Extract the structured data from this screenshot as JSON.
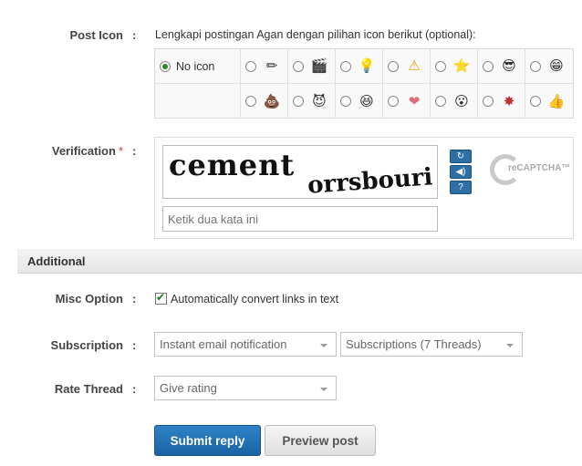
{
  "post_icon": {
    "label": "Post Icon",
    "colon": ":",
    "description": "Lengkapi postingan Agan dengan pilihan icon berikut (optional):",
    "no_icon_label": "No icon",
    "row1_icons": [
      {
        "name": "pencil-icon",
        "glyph": "✏"
      },
      {
        "name": "clapper-icon",
        "glyph": "🎬"
      },
      {
        "name": "lightbulb-icon",
        "glyph": "💡"
      },
      {
        "name": "warning-icon",
        "glyph": "⚠"
      },
      {
        "name": "star-icon",
        "glyph": "⭐"
      },
      {
        "name": "cool-face-icon",
        "glyph": "😎"
      },
      {
        "name": "smiley-face-icon",
        "glyph": "😁"
      }
    ],
    "row2_icons": [
      {
        "name": "poop-icon",
        "glyph": "💩"
      },
      {
        "name": "evil-face-icon",
        "glyph": "😈"
      },
      {
        "name": "grin-face-icon",
        "glyph": "😆"
      },
      {
        "name": "heart-icon",
        "glyph": "❤"
      },
      {
        "name": "shocked-face-icon",
        "glyph": "😮"
      },
      {
        "name": "angry-badge-icon",
        "glyph": "✸"
      },
      {
        "name": "thumbs-up-icon",
        "glyph": "👍"
      }
    ]
  },
  "verification": {
    "label": "Verification",
    "required_mark": "*",
    "colon": ":",
    "captcha_word1": "cement",
    "captcha_word2": "orrsbouri",
    "input_placeholder": "Ketik dua kata ini",
    "recaptcha_text": "reCAPTCHA™"
  },
  "additional": {
    "header": "Additional",
    "misc_label": "Misc Option",
    "misc_checkbox_label": "Automatically convert links in text",
    "subscription_label": "Subscription",
    "subscription_value": "Instant email notification",
    "subscription_threads": "Subscriptions (7 Threads)",
    "rate_label": "Rate Thread",
    "rate_value": "Give rating",
    "colon": ":"
  },
  "buttons": {
    "submit": "Submit reply",
    "preview": "Preview post"
  }
}
